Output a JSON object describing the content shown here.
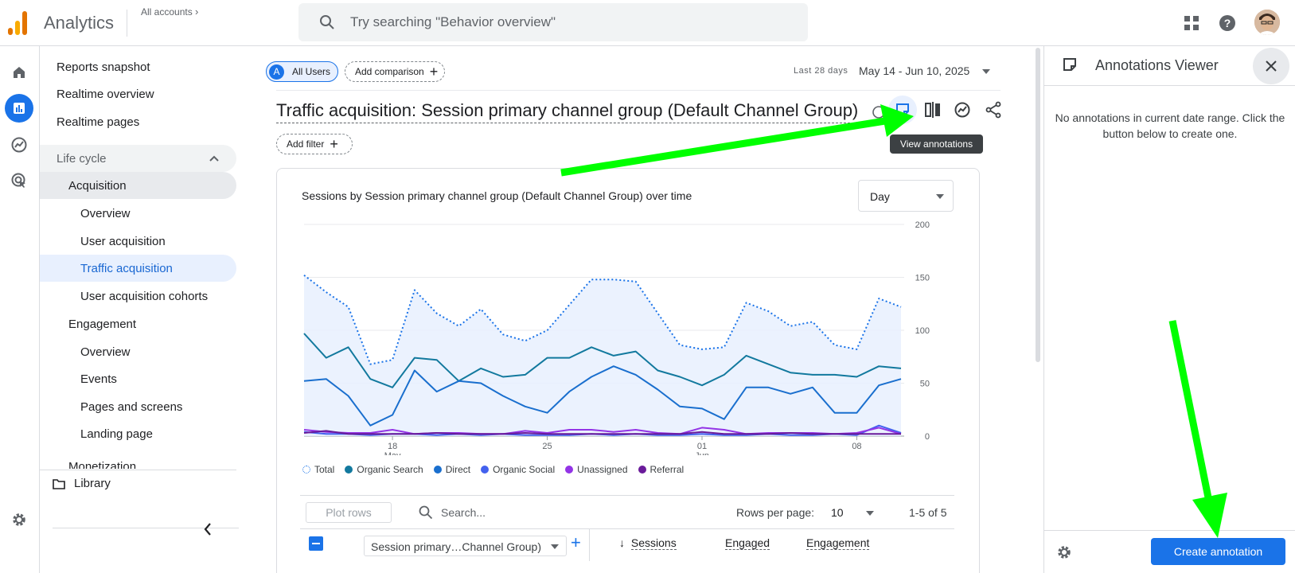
{
  "topbar": {
    "app_title": "Analytics",
    "account_crumb": "All accounts",
    "search_placeholder": "Try searching \"Behavior overview\""
  },
  "nav": {
    "top_items": [
      "Reports snapshot",
      "Realtime overview",
      "Realtime pages"
    ],
    "lifecycle": "Life cycle",
    "acquisition": "Acquisition",
    "acquisition_items": [
      "Overview",
      "User acquisition",
      "Traffic acquisition",
      "User acquisition cohorts"
    ],
    "engagement": "Engagement",
    "engagement_items": [
      "Overview",
      "Events",
      "Pages and screens",
      "Landing page"
    ],
    "monetization": "Monetization",
    "library": "Library"
  },
  "main": {
    "segment_badge": "A",
    "segment_label": "All Users",
    "add_comparison": "Add comparison",
    "date_prefix": "Last 28 days",
    "date_range": "May 14 - Jun 10, 2025",
    "report_title": "Traffic acquisition: Session primary channel group (Default Channel Group)",
    "add_filter": "Add filter",
    "tooltip": "View annotations"
  },
  "card": {
    "title": "Sessions by Session primary channel group (Default Channel Group) over time",
    "granularity": "Day",
    "plot_rows": "Plot rows",
    "search_placeholder": "Search...",
    "rows_per_page_label": "Rows per page:",
    "rows_per_page_value": "10",
    "pagination": "1-5 of 5",
    "dimension_select": "Session primary…Channel Group)",
    "columns": [
      "Sessions",
      "Engaged",
      "Engagement"
    ]
  },
  "chart_data": {
    "type": "line",
    "x": [
      "May 14",
      "May 15",
      "May 16",
      "May 17",
      "May 18",
      "May 19",
      "May 20",
      "May 21",
      "May 22",
      "May 23",
      "May 24",
      "May 25",
      "May 26",
      "May 27",
      "May 28",
      "May 29",
      "May 30",
      "May 31",
      "Jun 01",
      "Jun 02",
      "Jun 03",
      "Jun 04",
      "Jun 05",
      "Jun 06",
      "Jun 07",
      "Jun 08",
      "Jun 09",
      "Jun 10"
    ],
    "x_tick_labels": [
      {
        "index": 4,
        "day": "18",
        "month": "May"
      },
      {
        "index": 11,
        "day": "25",
        "month": ""
      },
      {
        "index": 18,
        "day": "01",
        "month": "Jun"
      },
      {
        "index": 25,
        "day": "08",
        "month": ""
      }
    ],
    "ylim": [
      0,
      200
    ],
    "y_ticks": [
      0,
      50,
      100,
      150,
      200
    ],
    "legend_position": "bottom-left",
    "series": [
      {
        "name": "Total",
        "color": "#1a73e8",
        "style": "dotted",
        "fill": true,
        "values": [
          152,
          136,
          122,
          68,
          72,
          138,
          116,
          104,
          120,
          96,
          90,
          100,
          124,
          148,
          148,
          146,
          116,
          86,
          82,
          84,
          126,
          118,
          104,
          108,
          86,
          82,
          130,
          122
        ]
      },
      {
        "name": "Organic Search",
        "color": "#12799e",
        "values": [
          97,
          74,
          84,
          54,
          46,
          74,
          72,
          52,
          64,
          56,
          58,
          74,
          74,
          84,
          76,
          80,
          62,
          56,
          48,
          58,
          76,
          68,
          60,
          58,
          58,
          56,
          66,
          64
        ]
      },
      {
        "name": "Direct",
        "color": "#1a6fce",
        "values": [
          52,
          54,
          38,
          10,
          20,
          62,
          42,
          52,
          50,
          38,
          28,
          22,
          42,
          56,
          66,
          58,
          44,
          28,
          26,
          16,
          46,
          46,
          40,
          46,
          22,
          22,
          48,
          54
        ]
      },
      {
        "name": "Organic Social",
        "color": "#4361ee",
        "values": [
          4,
          2,
          2,
          1,
          2,
          2,
          1,
          2,
          1,
          2,
          1,
          1,
          1,
          2,
          1,
          2,
          1,
          1,
          2,
          1,
          1,
          2,
          1,
          1,
          2,
          1,
          10,
          3
        ]
      },
      {
        "name": "Unassigned",
        "color": "#9334e6",
        "values": [
          6,
          4,
          3,
          3,
          6,
          2,
          3,
          3,
          2,
          2,
          5,
          3,
          6,
          6,
          4,
          6,
          3,
          2,
          8,
          6,
          2,
          3,
          3,
          3,
          2,
          3,
          8,
          2
        ]
      },
      {
        "name": "Referral",
        "color": "#6a1b9a",
        "values": [
          3,
          5,
          2,
          2,
          2,
          2,
          3,
          2,
          2,
          2,
          3,
          2,
          2,
          2,
          2,
          2,
          2,
          2,
          4,
          2,
          2,
          2,
          3,
          2,
          2,
          2,
          2,
          2
        ]
      }
    ]
  },
  "annotations": {
    "title": "Annotations Viewer",
    "empty_message": "No annotations in current date range. Click the button below to create one.",
    "create_button": "Create annotation"
  },
  "colors": {
    "accent": "#1a73e8",
    "highlight_arrow": "#00ff00"
  }
}
